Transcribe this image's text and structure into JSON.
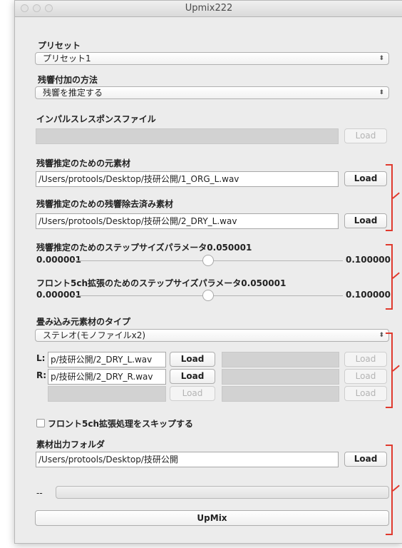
{
  "window": {
    "title": "Upmix222"
  },
  "preset": {
    "label": "プリセット",
    "value": "プリセット1"
  },
  "reverb_method": {
    "label": "残響付加の方法",
    "value": "残響を推定する"
  },
  "impulse": {
    "label": "インパルスレスポンスファイル",
    "value": "",
    "load": "Load"
  },
  "orig_source": {
    "label": "残響推定のための元素材",
    "path": "/Users/protools/Desktop/技研公開/1_ORG_L.wav",
    "load": "Load"
  },
  "dry_source": {
    "label": "残響推定のための残響除去済み素材",
    "path": "/Users/protools/Desktop/技研公開/2_DRY_L.wav",
    "load": "Load"
  },
  "step1": {
    "label": "残響推定のためのステップサイズパラメータ0.050001",
    "min": "0.000001",
    "max": "0.100000",
    "value": 0.050001
  },
  "step2": {
    "label": "フロント5ch拡張のためのステップサイズパラメータ0.050001",
    "min": "0.000001",
    "max": "0.100000",
    "value": 0.050001
  },
  "conv_type": {
    "label": "畳み込み元素材のタイプ",
    "value": "ステレオ(モノファイルx2)"
  },
  "files": {
    "l_label": "L:",
    "r_label": "R:",
    "l_path": "p/技研公開/2_DRY_L.wav",
    "r_path": "p/技研公開/2_DRY_R.wav",
    "load": "Load"
  },
  "skip_front": {
    "label": "フロント5ch拡張処理をスキップする",
    "checked": false
  },
  "output": {
    "label": "素材出力フォルダ",
    "path": "/Users/protools/Desktop/技研公開",
    "load": "Load"
  },
  "progress": {
    "status": "--",
    "value": 0
  },
  "upmix_button": "UpMix",
  "colors": {
    "bracket": "#e03a2e",
    "window_bg": "#ececec"
  }
}
